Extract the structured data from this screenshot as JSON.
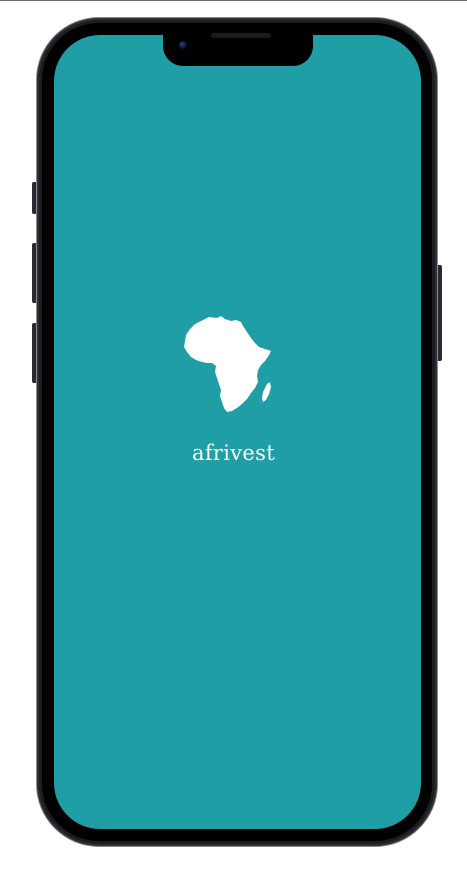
{
  "app": {
    "name": "afrivest",
    "background_color": "#209ea6",
    "logo_icon": "africa-continent-icon"
  }
}
